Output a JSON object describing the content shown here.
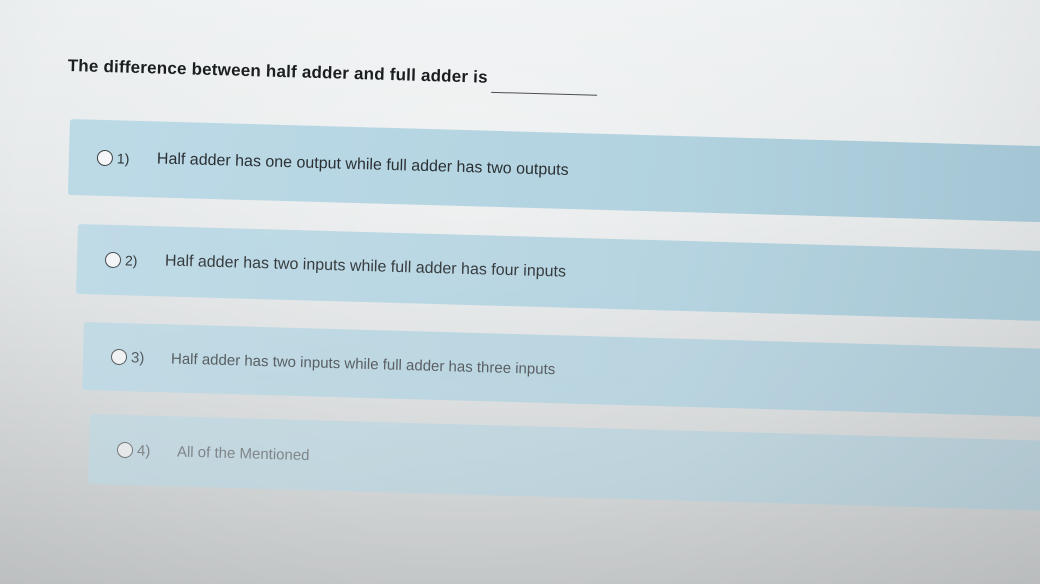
{
  "question": {
    "text": "The difference between half adder and full adder is"
  },
  "options": [
    {
      "number": "1)",
      "label": "Half adder has one output while full adder has two outputs"
    },
    {
      "number": "2)",
      "label": "Half adder has two inputs while full adder has four inputs"
    },
    {
      "number": "3)",
      "label": "Half adder has two inputs while full adder has three inputs"
    },
    {
      "number": "4)",
      "label": "All of the Mentioned"
    }
  ],
  "colors": {
    "option_background": "#b3d5e3",
    "page_background": "#e6e9ea",
    "text": "#2a3033"
  }
}
